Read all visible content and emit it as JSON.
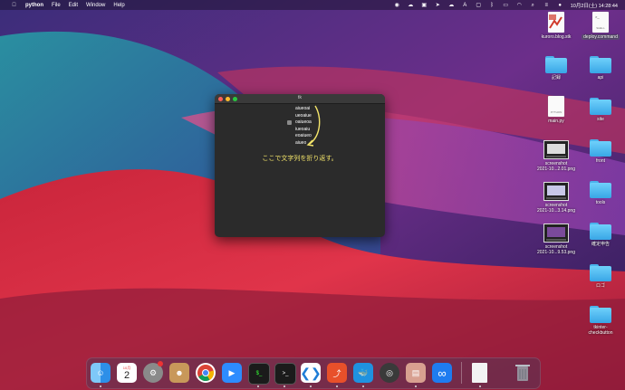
{
  "menubar": {
    "apple_icon": "apple-icon",
    "app_name": "python",
    "items": [
      "File",
      "Edit",
      "Window",
      "Help"
    ],
    "datetime": "10月2日(土) 14:28:44"
  },
  "desktop": {
    "items": [
      {
        "label": "kuroro.blog.stk",
        "icon": "document-icon"
      },
      {
        "label": "deploy.command",
        "icon": "shell-document-icon",
        "doc_text": "SHELL"
      },
      {
        "label": "記録",
        "icon": "folder-icon"
      },
      {
        "label": "api",
        "icon": "folder-icon"
      },
      {
        "label": "main.py",
        "icon": "python-document-icon",
        "doc_text": "PYTHON"
      },
      {
        "label": "site",
        "icon": "folder-icon"
      },
      {
        "label": "screenshot\n2021-10...2.01.png",
        "icon": "screenshot-icon"
      },
      {
        "label": "front",
        "icon": "folder-icon"
      },
      {
        "label": "screenshot\n2021-10...3.14.png",
        "icon": "screenshot-icon"
      },
      {
        "label": "tools",
        "icon": "folder-icon"
      },
      {
        "label": "screenshot\n2021-10...9.53.png",
        "icon": "screenshot-icon"
      },
      {
        "label": "確定申告",
        "icon": "folder-icon"
      },
      {
        "label": "ロゴ",
        "icon": "folder-icon"
      },
      {
        "label": "tkinter-\ncheckbutton",
        "icon": "folder-icon"
      }
    ]
  },
  "window": {
    "title": "tk",
    "checkbox_text_lines": [
      "aiueoai",
      "ueoaiue",
      "oaiueoa",
      "iueoaiu",
      "eoaiueo",
      "aiueo"
    ],
    "annotation": "ここで文字列を折り返す。",
    "annotation_color": "#f4e56a"
  },
  "dock": {
    "calendar_month": "10月",
    "calendar_day": "2",
    "apps": [
      "Finder",
      "Calendar",
      "System Preferences",
      "Contacts",
      "Chrome",
      "Zoom",
      "Terminal",
      "Terminal",
      "VS Code",
      "Sourcetree",
      "Docker",
      "QuickTime",
      "Preview",
      "Infinity",
      "Document",
      "Trash"
    ]
  }
}
